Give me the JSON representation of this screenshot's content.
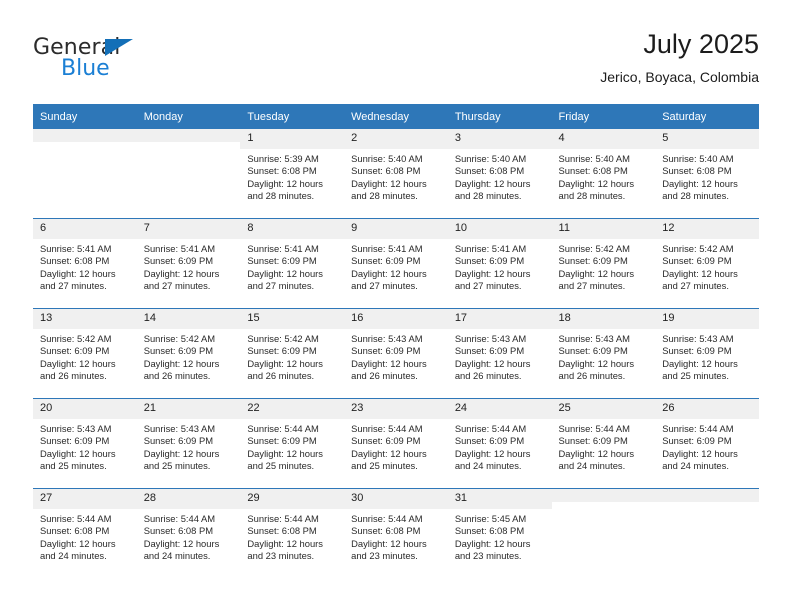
{
  "brand": {
    "name_top": "General",
    "name_bottom": "Blue",
    "triangle_color": "#136fb7",
    "blue_color": "#1b7fd4"
  },
  "header": {
    "title": "July 2025",
    "subtitle": "Jerico, Boyaca, Colombia"
  },
  "theme": {
    "header_blue": "#2e77b8",
    "daynum_band": "#f0f0f0",
    "text": "#2a2a2a"
  },
  "calendar": {
    "weekday_headers": [
      "Sunday",
      "Monday",
      "Tuesday",
      "Wednesday",
      "Thursday",
      "Friday",
      "Saturday"
    ],
    "weeks": [
      [
        {
          "day": "",
          "sunrise": "",
          "sunset": "",
          "daylight_line1": "",
          "daylight_line2": ""
        },
        {
          "day": "",
          "sunrise": "",
          "sunset": "",
          "daylight_line1": "",
          "daylight_line2": ""
        },
        {
          "day": "1",
          "sunrise": "Sunrise: 5:39 AM",
          "sunset": "Sunset: 6:08 PM",
          "daylight_line1": "Daylight: 12 hours",
          "daylight_line2": "and 28 minutes."
        },
        {
          "day": "2",
          "sunrise": "Sunrise: 5:40 AM",
          "sunset": "Sunset: 6:08 PM",
          "daylight_line1": "Daylight: 12 hours",
          "daylight_line2": "and 28 minutes."
        },
        {
          "day": "3",
          "sunrise": "Sunrise: 5:40 AM",
          "sunset": "Sunset: 6:08 PM",
          "daylight_line1": "Daylight: 12 hours",
          "daylight_line2": "and 28 minutes."
        },
        {
          "day": "4",
          "sunrise": "Sunrise: 5:40 AM",
          "sunset": "Sunset: 6:08 PM",
          "daylight_line1": "Daylight: 12 hours",
          "daylight_line2": "and 28 minutes."
        },
        {
          "day": "5",
          "sunrise": "Sunrise: 5:40 AM",
          "sunset": "Sunset: 6:08 PM",
          "daylight_line1": "Daylight: 12 hours",
          "daylight_line2": "and 28 minutes."
        }
      ],
      [
        {
          "day": "6",
          "sunrise": "Sunrise: 5:41 AM",
          "sunset": "Sunset: 6:08 PM",
          "daylight_line1": "Daylight: 12 hours",
          "daylight_line2": "and 27 minutes."
        },
        {
          "day": "7",
          "sunrise": "Sunrise: 5:41 AM",
          "sunset": "Sunset: 6:09 PM",
          "daylight_line1": "Daylight: 12 hours",
          "daylight_line2": "and 27 minutes."
        },
        {
          "day": "8",
          "sunrise": "Sunrise: 5:41 AM",
          "sunset": "Sunset: 6:09 PM",
          "daylight_line1": "Daylight: 12 hours",
          "daylight_line2": "and 27 minutes."
        },
        {
          "day": "9",
          "sunrise": "Sunrise: 5:41 AM",
          "sunset": "Sunset: 6:09 PM",
          "daylight_line1": "Daylight: 12 hours",
          "daylight_line2": "and 27 minutes."
        },
        {
          "day": "10",
          "sunrise": "Sunrise: 5:41 AM",
          "sunset": "Sunset: 6:09 PM",
          "daylight_line1": "Daylight: 12 hours",
          "daylight_line2": "and 27 minutes."
        },
        {
          "day": "11",
          "sunrise": "Sunrise: 5:42 AM",
          "sunset": "Sunset: 6:09 PM",
          "daylight_line1": "Daylight: 12 hours",
          "daylight_line2": "and 27 minutes."
        },
        {
          "day": "12",
          "sunrise": "Sunrise: 5:42 AM",
          "sunset": "Sunset: 6:09 PM",
          "daylight_line1": "Daylight: 12 hours",
          "daylight_line2": "and 27 minutes."
        }
      ],
      [
        {
          "day": "13",
          "sunrise": "Sunrise: 5:42 AM",
          "sunset": "Sunset: 6:09 PM",
          "daylight_line1": "Daylight: 12 hours",
          "daylight_line2": "and 26 minutes."
        },
        {
          "day": "14",
          "sunrise": "Sunrise: 5:42 AM",
          "sunset": "Sunset: 6:09 PM",
          "daylight_line1": "Daylight: 12 hours",
          "daylight_line2": "and 26 minutes."
        },
        {
          "day": "15",
          "sunrise": "Sunrise: 5:42 AM",
          "sunset": "Sunset: 6:09 PM",
          "daylight_line1": "Daylight: 12 hours",
          "daylight_line2": "and 26 minutes."
        },
        {
          "day": "16",
          "sunrise": "Sunrise: 5:43 AM",
          "sunset": "Sunset: 6:09 PM",
          "daylight_line1": "Daylight: 12 hours",
          "daylight_line2": "and 26 minutes."
        },
        {
          "day": "17",
          "sunrise": "Sunrise: 5:43 AM",
          "sunset": "Sunset: 6:09 PM",
          "daylight_line1": "Daylight: 12 hours",
          "daylight_line2": "and 26 minutes."
        },
        {
          "day": "18",
          "sunrise": "Sunrise: 5:43 AM",
          "sunset": "Sunset: 6:09 PM",
          "daylight_line1": "Daylight: 12 hours",
          "daylight_line2": "and 26 minutes."
        },
        {
          "day": "19",
          "sunrise": "Sunrise: 5:43 AM",
          "sunset": "Sunset: 6:09 PM",
          "daylight_line1": "Daylight: 12 hours",
          "daylight_line2": "and 25 minutes."
        }
      ],
      [
        {
          "day": "20",
          "sunrise": "Sunrise: 5:43 AM",
          "sunset": "Sunset: 6:09 PM",
          "daylight_line1": "Daylight: 12 hours",
          "daylight_line2": "and 25 minutes."
        },
        {
          "day": "21",
          "sunrise": "Sunrise: 5:43 AM",
          "sunset": "Sunset: 6:09 PM",
          "daylight_line1": "Daylight: 12 hours",
          "daylight_line2": "and 25 minutes."
        },
        {
          "day": "22",
          "sunrise": "Sunrise: 5:44 AM",
          "sunset": "Sunset: 6:09 PM",
          "daylight_line1": "Daylight: 12 hours",
          "daylight_line2": "and 25 minutes."
        },
        {
          "day": "23",
          "sunrise": "Sunrise: 5:44 AM",
          "sunset": "Sunset: 6:09 PM",
          "daylight_line1": "Daylight: 12 hours",
          "daylight_line2": "and 25 minutes."
        },
        {
          "day": "24",
          "sunrise": "Sunrise: 5:44 AM",
          "sunset": "Sunset: 6:09 PM",
          "daylight_line1": "Daylight: 12 hours",
          "daylight_line2": "and 24 minutes."
        },
        {
          "day": "25",
          "sunrise": "Sunrise: 5:44 AM",
          "sunset": "Sunset: 6:09 PM",
          "daylight_line1": "Daylight: 12 hours",
          "daylight_line2": "and 24 minutes."
        },
        {
          "day": "26",
          "sunrise": "Sunrise: 5:44 AM",
          "sunset": "Sunset: 6:09 PM",
          "daylight_line1": "Daylight: 12 hours",
          "daylight_line2": "and 24 minutes."
        }
      ],
      [
        {
          "day": "27",
          "sunrise": "Sunrise: 5:44 AM",
          "sunset": "Sunset: 6:08 PM",
          "daylight_line1": "Daylight: 12 hours",
          "daylight_line2": "and 24 minutes."
        },
        {
          "day": "28",
          "sunrise": "Sunrise: 5:44 AM",
          "sunset": "Sunset: 6:08 PM",
          "daylight_line1": "Daylight: 12 hours",
          "daylight_line2": "and 24 minutes."
        },
        {
          "day": "29",
          "sunrise": "Sunrise: 5:44 AM",
          "sunset": "Sunset: 6:08 PM",
          "daylight_line1": "Daylight: 12 hours",
          "daylight_line2": "and 23 minutes."
        },
        {
          "day": "30",
          "sunrise": "Sunrise: 5:44 AM",
          "sunset": "Sunset: 6:08 PM",
          "daylight_line1": "Daylight: 12 hours",
          "daylight_line2": "and 23 minutes."
        },
        {
          "day": "31",
          "sunrise": "Sunrise: 5:45 AM",
          "sunset": "Sunset: 6:08 PM",
          "daylight_line1": "Daylight: 12 hours",
          "daylight_line2": "and 23 minutes."
        },
        {
          "day": "",
          "sunrise": "",
          "sunset": "",
          "daylight_line1": "",
          "daylight_line2": ""
        },
        {
          "day": "",
          "sunrise": "",
          "sunset": "",
          "daylight_line1": "",
          "daylight_line2": ""
        }
      ]
    ]
  }
}
